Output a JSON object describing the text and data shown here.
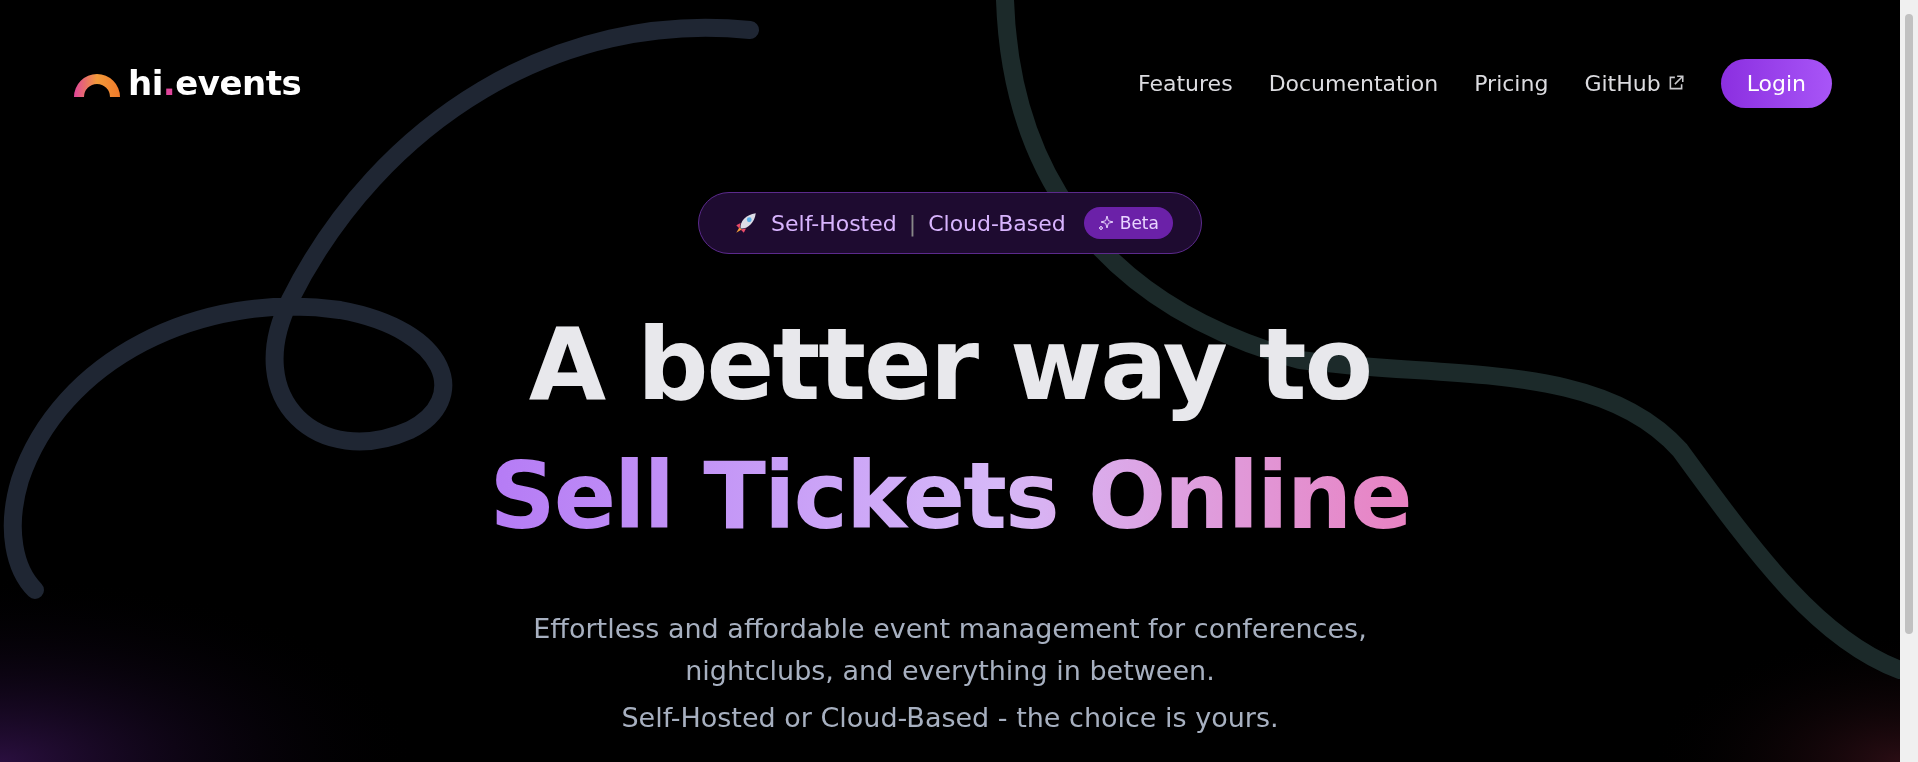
{
  "header": {
    "logo": {
      "before": "hi",
      "dot": ".",
      "after": "events"
    },
    "nav": [
      {
        "label": "Features",
        "external": false
      },
      {
        "label": "Documentation",
        "external": false
      },
      {
        "label": "Pricing",
        "external": false
      },
      {
        "label": "GitHub",
        "external": true
      }
    ],
    "login_button": "Login"
  },
  "hero": {
    "badge": {
      "left": "Self-Hosted",
      "separator": "|",
      "right": "Cloud-Based",
      "tag": "Beta"
    },
    "headline": {
      "line_1": "A better way to",
      "line_2": "Sell Tickets Online"
    },
    "description": "Effortless and affordable event management for conferences, nightclubs, and everything in between.",
    "tagline": "Self-Hosted or Cloud-Based - the choice is yours."
  }
}
